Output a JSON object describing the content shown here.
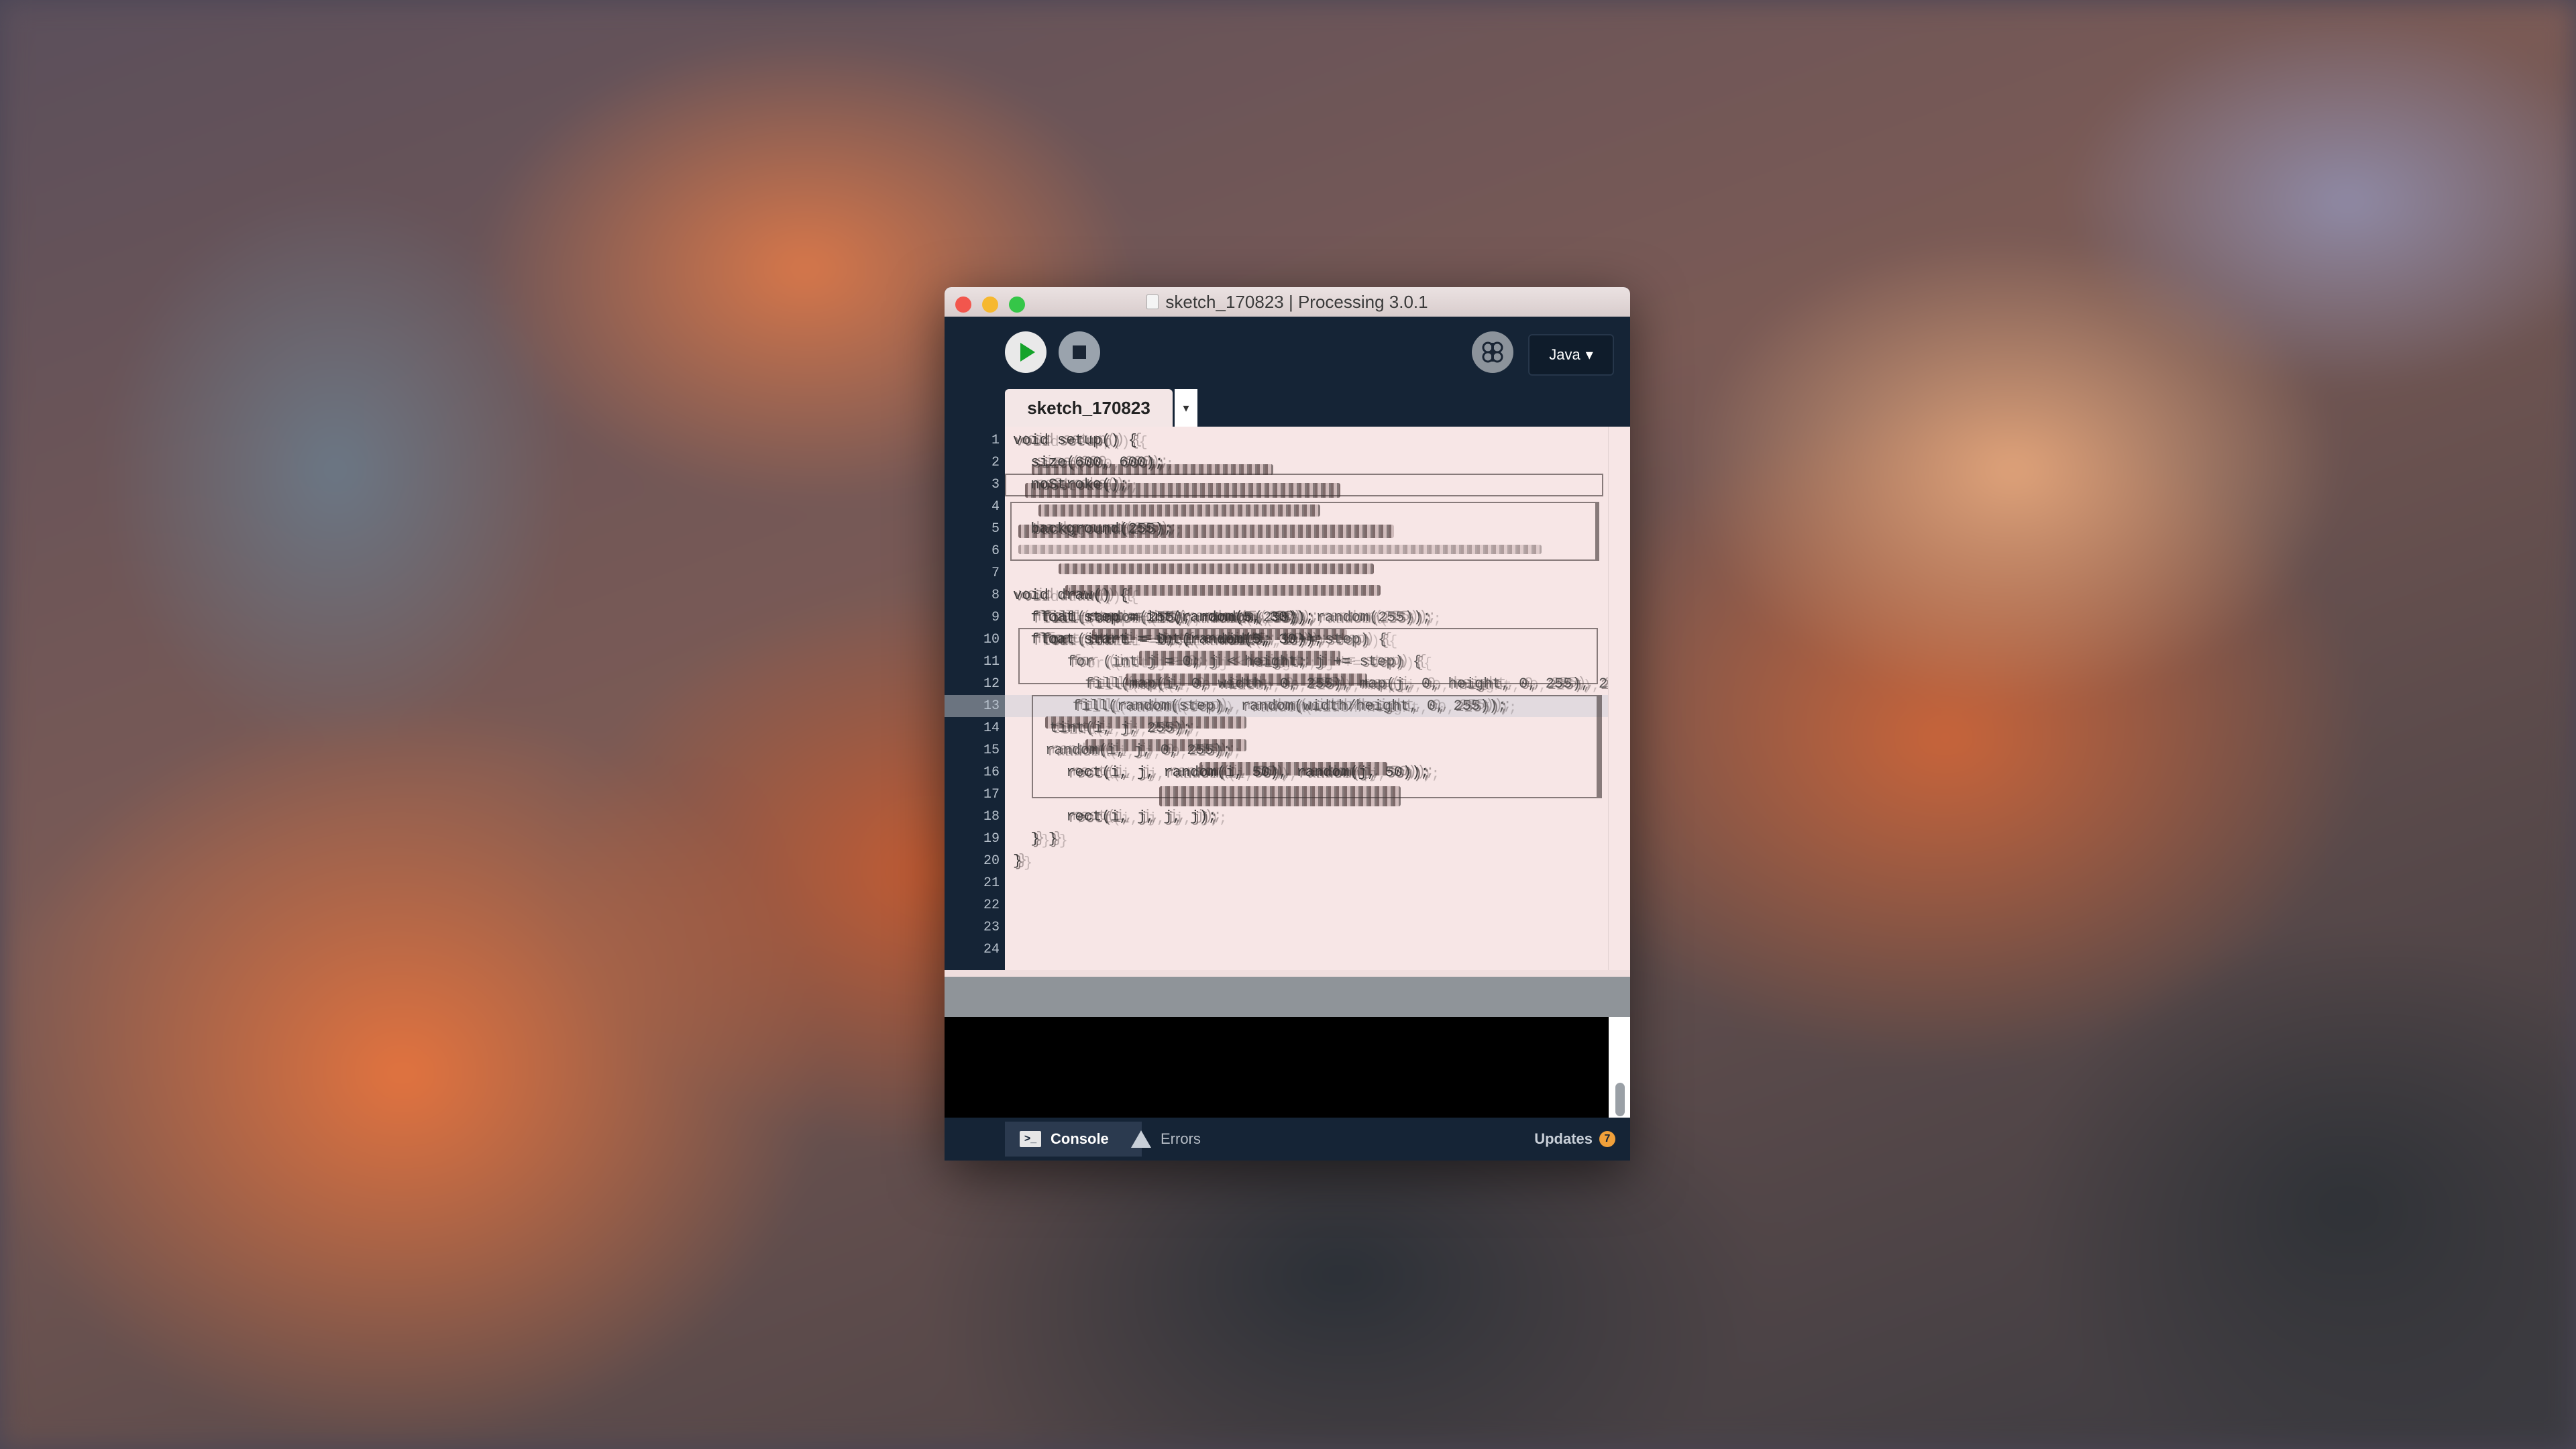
{
  "window": {
    "title": "sketch_170823 | Processing 3.0.1"
  },
  "toolbar": {
    "run_icon": "play-icon",
    "stop_icon": "stop-icon",
    "debug_icon": "debugger-butterfly-icon",
    "mode": "Java",
    "mode_caret": "▾"
  },
  "tabs": {
    "active": "sketch_170823",
    "menu_caret": "▾"
  },
  "editor": {
    "current_line": 13,
    "line_numbers": [
      "1",
      "2",
      "3",
      "4",
      "5",
      "6",
      "7",
      "8",
      "9",
      "10",
      "11",
      "12",
      "13",
      "14",
      "15",
      "16",
      "17",
      "18",
      "19",
      "20",
      "21",
      "22",
      "23",
      "24"
    ],
    "lines": [
      "void setup() {",
      "  size(600, 600);",
      "  noStroke();",
      "",
      "  background(255);",
      "",
      "",
      "void draw() {",
      "  float step = int(random(5, 30));",
      "  float start = int(random(5, 30));",
      "",
      "",
      "",
      "",
      "",
      "      rect(i, j, random(i, 50), random(j, 50));",
      "",
      "      rect(i, j, j, j);",
      "  } }",
      "}",
      "",
      "",
      "",
      ""
    ],
    "ghost_text": [
      "  fill(random(255), random(255), random(255));",
      "  for (int i = 0; i < width; i += step) {",
      "    for (int j = 0; j < height; j += step) {",
      "      fill(map(i, 0, width, 0, 255), map(j, 0, height, 0, 255), 255);",
      "    fill(random(step), random(width/height, 0, 255));",
      "  tint(i, j, 255);",
      "random(i, j, 0, 255);"
    ]
  },
  "footer": {
    "console_label": "Console",
    "console_icon": "terminal-icon",
    "errors_label": "Errors",
    "errors_icon": "warning-icon",
    "updates_label": "Updates",
    "updates_count": "7"
  },
  "colors": {
    "window_bg": "#152436",
    "editor_bg": "#f7e6e6",
    "run_green": "#14a32a",
    "updates_badge": "#f0a03a"
  }
}
